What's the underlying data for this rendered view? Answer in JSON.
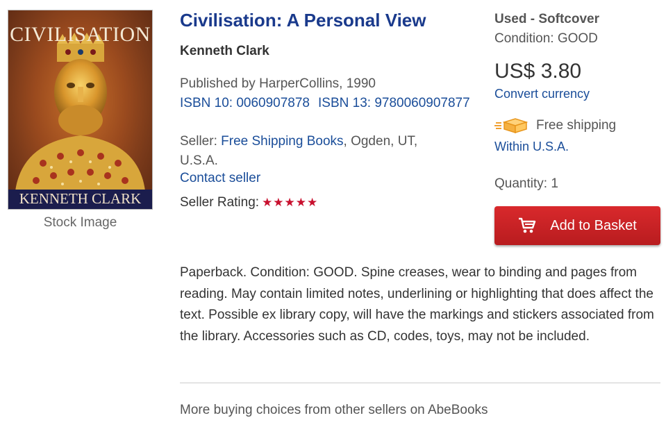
{
  "cover": {
    "title": "CIVILISATION",
    "author": "KENNETH CLARK",
    "caption": "Stock Image"
  },
  "listing": {
    "title": "Civilisation: A Personal View",
    "author": "Kenneth Clark",
    "published": "Published by HarperCollins, 1990",
    "isbn10": "ISBN 10: 0060907878",
    "isbn13": "ISBN 13: 9780060907877",
    "seller_prefix": "Seller:",
    "seller_name": "Free Shipping Books",
    "seller_location": ", Ogden, UT, U.S.A.",
    "contact_seller": "Contact seller",
    "rating_label": "Seller Rating:",
    "rating_stars": "★★★★★",
    "rating_value": 5
  },
  "purchase": {
    "binding": "Used - Softcover",
    "condition": "Condition: GOOD",
    "price": "US$ 3.80",
    "convert_currency": "Convert currency",
    "shipping": "Free shipping",
    "shipping_region": "Within U.S.A.",
    "quantity": "Quantity: 1",
    "add_to_basket": "Add to Basket"
  },
  "description": "Paperback. Condition: GOOD. Spine creases, wear to binding and pages from reading. May contain limited notes, underlining or highlighting that does affect the text. Possible ex library copy, will have the markings and stickers associated from the library. Accessories such as CD, codes, toys, may not be included.",
  "more_choices": "More buying choices from other sellers on AbeBooks",
  "colors": {
    "title_blue": "#1a3a8c",
    "link_blue": "#1a4d99",
    "button_red": "#c8202a",
    "star_red": "#c8102e"
  }
}
